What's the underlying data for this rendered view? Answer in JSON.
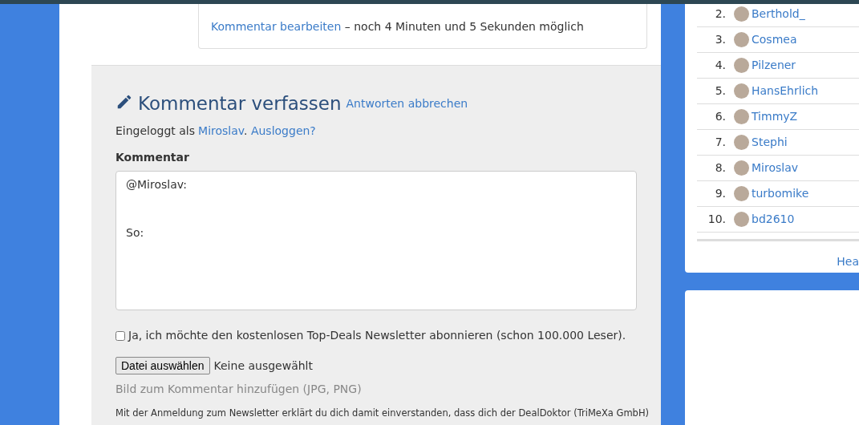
{
  "edit_notice": {
    "link": "Kommentar bearbeiten",
    "text": "– noch 4 Minuten und 5 Sekunden möglich"
  },
  "comment_form": {
    "title": "Kommentar verfassen",
    "cancel_link": "Antworten abbrechen",
    "logged_in_prefix": "Eingeloggt als",
    "user_link": "Miroslav",
    "user_link_suffix": ".",
    "logout_link": "Ausloggen?",
    "field_label": "Kommentar",
    "textarea_value": "@Miroslav:\n\n\nSo:",
    "newsletter": {
      "label": "Ja, ich möchte den kostenlosen Top-Deals Newsletter abonnieren (schon 100.000 Leser).",
      "checked": false
    },
    "file_button": "Datei auswählen",
    "file_status": "Keine ausgewählt",
    "file_hint": "Bild zum Kommentar hinzufügen (JPG, PNG)",
    "disclaimer": "Mit der Anmeldung zum Newsletter erklärt du dich damit einverstanden, dass dich der DealDoktor (TriMeXa GmbH)"
  },
  "sidebar": {
    "ranking": [
      {
        "rank": "2.",
        "name": "Berthold_"
      },
      {
        "rank": "3.",
        "name": "Cosmea"
      },
      {
        "rank": "4.",
        "name": "Pilzener"
      },
      {
        "rank": "5.",
        "name": "HansEhrlich"
      },
      {
        "rank": "6.",
        "name": "TimmyZ"
      },
      {
        "rank": "7.",
        "name": "Stephi"
      },
      {
        "rank": "8.",
        "name": "Miroslav"
      },
      {
        "rank": "9.",
        "name": "turbomike"
      },
      {
        "rank": "10.",
        "name": "bd2610"
      }
    ],
    "footer_link": "Hea"
  }
}
